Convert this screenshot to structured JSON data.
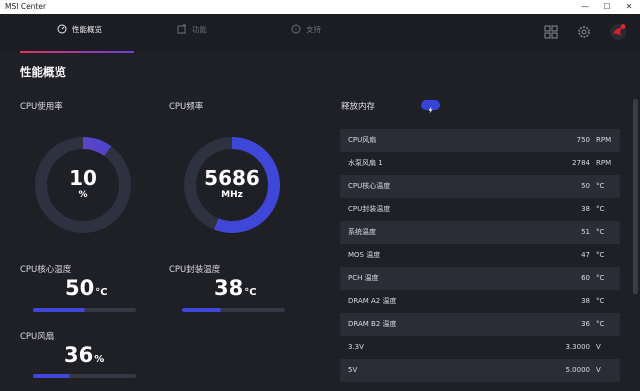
{
  "app": {
    "title": "MSI Center"
  },
  "window_controls": {
    "minimize": "—",
    "maximize": "☐",
    "close": "✕"
  },
  "nav": {
    "tabs": [
      {
        "label": "性能概览",
        "icon": "gauge-icon"
      },
      {
        "label": "功能",
        "icon": "features-icon"
      },
      {
        "label": "支持",
        "icon": "support-icon"
      }
    ],
    "icons": [
      "grid-icon",
      "gear-icon",
      "msi-dragon-logo"
    ]
  },
  "page": {
    "title": "性能概览"
  },
  "cpu_usage": {
    "label": "CPU使用率",
    "value": "10",
    "unit": "%",
    "percent": 10
  },
  "cpu_freq": {
    "label": "CPU频率",
    "value": "5686",
    "unit": "MHz",
    "percent": 0.56
  },
  "cpu_core_temp": {
    "label": "CPU核心温度",
    "value": "50",
    "unit": "°C",
    "level": 0.5
  },
  "cpu_package_temp": {
    "label": "CPU封装温度",
    "value": "38",
    "unit": "°C",
    "level": 0.38
  },
  "cpu_fan": {
    "label": "CPU风扇",
    "value": "36",
    "unit": "%",
    "level": 0.36
  },
  "release_memory": {
    "label": "释放内存"
  },
  "table": {
    "rows": [
      {
        "label": "CPU风扇",
        "value": "750",
        "unit": "RPM"
      },
      {
        "label": "水泵风扇 1",
        "value": "2784",
        "unit": "RPM"
      },
      {
        "label": "CPU核心温度",
        "value": "50",
        "unit": "°C"
      },
      {
        "label": "CPU封装温度",
        "value": "38",
        "unit": "°C"
      },
      {
        "label": "系统温度",
        "value": "51",
        "unit": "°C"
      },
      {
        "label": "MOS 温度",
        "value": "47",
        "unit": "°C"
      },
      {
        "label": "PCH 温度",
        "value": "60",
        "unit": "°C"
      },
      {
        "label": "DRAM A2 温度",
        "value": "38",
        "unit": "°C"
      },
      {
        "label": "DRAM B2 温度",
        "value": "36",
        "unit": "°C"
      },
      {
        "label": "3.3V",
        "value": "3.3000",
        "unit": "V"
      },
      {
        "label": "5V",
        "value": "5.0000",
        "unit": "V"
      }
    ]
  },
  "colors": {
    "accent": "#3f47d9",
    "gauge_start": "#b43a8a",
    "track": "#2e3140",
    "bg": "#1f2026"
  }
}
